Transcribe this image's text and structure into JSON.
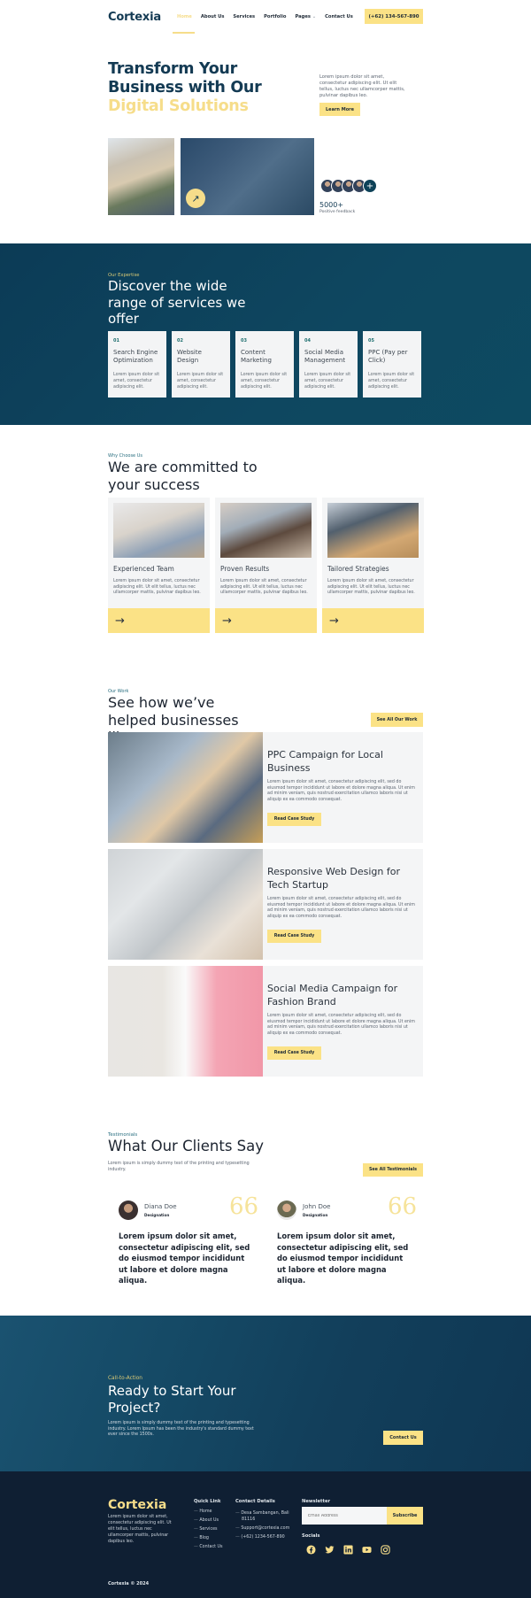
{
  "header": {
    "logo": "Cortexia",
    "nav": [
      "Home",
      "About Us",
      "Services",
      "Portfolio",
      "Pages",
      "Contact Us"
    ],
    "active_nav": "Home",
    "phone": "(+62) 134-567-890"
  },
  "hero": {
    "title_line1": "Transform Your",
    "title_line2": "Business with Our",
    "title_highlight": "Digital Solutions",
    "description": "Lorem ipsum dolor sit amet, consectetur adipiscing elit. Ut elit tellus, luctus nec ullamcorper mattis, pulvinar dapibus leo.",
    "cta_label": "Learn More",
    "feedback_count": "5000+",
    "feedback_label": "Positive feedback",
    "avatar_plus": "+"
  },
  "services": {
    "eyebrow": "Our Expertise",
    "title": "Discover the wide range of services we offer",
    "items": [
      {
        "num": "01",
        "name": "Search Engine Optimization",
        "desc": "Lorem ipsum dolor sit amet, consectetur adipiscing elit."
      },
      {
        "num": "02",
        "name": "Website Design",
        "desc": "Lorem ipsum dolor sit amet, consectetur adipiscing elit."
      },
      {
        "num": "03",
        "name": "Content Marketing",
        "desc": "Lorem ipsum dolor sit amet, consectetur adipiscing elit."
      },
      {
        "num": "04",
        "name": "Social Media Management",
        "desc": "Lorem ipsum dolor sit amet, consectetur adipiscing elit."
      },
      {
        "num": "05",
        "name": "PPC (Pay per Click)",
        "desc": "Lorem ipsum dolor sit amet, consectetur adipiscing elit."
      }
    ]
  },
  "why": {
    "eyebrow": "Why Choose Us",
    "title": "We are committed to your success",
    "items": [
      {
        "name": "Experienced Team",
        "desc": "Lorem ipsum dolor sit amet, consectetur adipiscing elit. Ut elit tellus, luctus nec ullamcorper mattis, pulvinar dapibus leo."
      },
      {
        "name": "Proven Results",
        "desc": "Lorem ipsum dolor sit amet, consectetur adipiscing elit. Ut elit tellus, luctus nec ullamcorper mattis, pulvinar dapibus leo."
      },
      {
        "name": "Tailored Strategies",
        "desc": "Lorem ipsum dolor sit amet, consectetur adipiscing elit. Ut elit tellus, luctus nec ullamcorper mattis, pulvinar dapibus leo."
      }
    ]
  },
  "work": {
    "eyebrow": "Our Work",
    "title": "See how we’ve helped businesses like yours",
    "see_all": "See All Our Work",
    "items": [
      {
        "name": "PPC Campaign for Local Business",
        "desc": "Lorem ipsum dolor sit amet, consectetur adipiscing elit, sed do eiusmod tempor incididunt ut labore et dolore magna aliqua. Ut enim ad minim veniam, quis nostrud exercitation ullamco laboris nisi ut aliquip ex ea commodo consequat.",
        "cta": "Read Case Study"
      },
      {
        "name": "Responsive Web Design for Tech Startup",
        "desc": "Lorem ipsum dolor sit amet, consectetur adipiscing elit, sed do eiusmod tempor incididunt ut labore et dolore magna aliqua. Ut enim ad minim veniam, quis nostrud exercitation ullamco laboris nisi ut aliquip ex ea commodo consequat.",
        "cta": "Read Case Study"
      },
      {
        "name": "Social Media Campaign for Fashion Brand",
        "desc": "Lorem ipsum dolor sit amet, consectetur adipiscing elit, sed do eiusmod tempor incididunt ut labore et dolore magna aliqua. Ut enim ad minim veniam, quis nostrud exercitation ullamco laboris nisi ut aliquip ex ea commodo consequat.",
        "cta": "Read Case Study"
      }
    ]
  },
  "testimonials": {
    "eyebrow": "Testimonials",
    "title": "What Our Clients Say",
    "subtitle": "Lorem ipsum is simply dummy text of the printing and typesetting industry.",
    "see_all": "See All Testimonials",
    "items": [
      {
        "name": "Diana Doe",
        "designation": "Designation",
        "quote_mark": "66",
        "text": "Lorem ipsum dolor sit amet, consectetur adipiscing elit, sed do eiusmod tempor incididunt ut labore et dolore magna aliqua."
      },
      {
        "name": "John Doe",
        "designation": "Designation",
        "quote_mark": "66",
        "text": "Lorem ipsum dolor sit amet, consectetur adipiscing elit, sed do eiusmod tempor incididunt ut labore et dolore magna aliqua."
      }
    ]
  },
  "cta": {
    "eyebrow": "Call-to-Action",
    "title": "Ready to Start Your Project?",
    "description": "Lorem ipsum is simply dummy text of the printing and typesetting industry. Lorem Ipsum has been the industry's standard dummy text ever since the 1500s.",
    "button": "Contact Us"
  },
  "footer": {
    "logo": "Cortexia",
    "description": "Lorem ipsum dolor sit amet, consectetur adipiscing elit. Ut elit tellus, luctus nec ullamcorper mattis, pulvinar dapibus leo.",
    "quick_link_title": "Quick Link",
    "quick_links": [
      "Home",
      "About Us",
      "Services",
      "Blog",
      "Contact Us"
    ],
    "contact_title": "Contact Details",
    "contacts": [
      "Desa Sambangan, Bali 81116",
      "Support@cortexia.com",
      "(+62) 1234-567-890"
    ],
    "newsletter_title": "Newsletter",
    "newsletter_placeholder": "Email Address",
    "subscribe": "Subscribe",
    "socials_title": "Socials",
    "socials": [
      "facebook",
      "twitter",
      "linkedin",
      "youtube",
      "instagram"
    ],
    "copyright": "Cortexia © 2024"
  },
  "colors": {
    "primary": "#0e4258",
    "accent": "#fbe286",
    "footer_bg": "#0f1f33"
  }
}
